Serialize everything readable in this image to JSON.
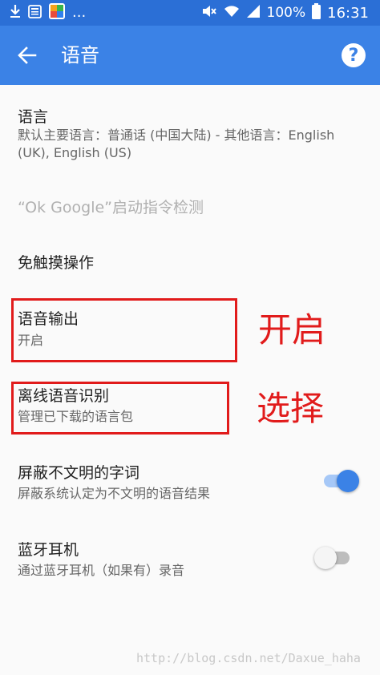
{
  "status_bar": {
    "time": "16:31",
    "battery": "100%",
    "more": "...",
    "icons": [
      "download-icon",
      "news-icon",
      "app-icon",
      "mute-icon",
      "wifi-icon",
      "signal-icon",
      "battery-icon"
    ]
  },
  "app_bar": {
    "title": "语音",
    "help_label": "?",
    "color": "#3b82e6"
  },
  "items": {
    "language": {
      "title": "语言",
      "subtitle": "默认主要语言：普通话 (中国大陆) - 其他语言：English (UK), English (US)"
    },
    "ok_google": {
      "title": "“Ok Google”启动指令检测"
    },
    "handsfree": {
      "title": "免触摸操作"
    },
    "voice_output": {
      "title": "语音输出",
      "subtitle": "开启"
    },
    "offline": {
      "title": "离线语音识别",
      "subtitle": "管理已下载的语言包"
    },
    "block_offensive": {
      "title": "屏蔽不文明的字词",
      "subtitle": "屏蔽系统认定为不文明的语音结果",
      "enabled": true
    },
    "bluetooth": {
      "title": "蓝牙耳机",
      "subtitle": "通过蓝牙耳机（如果有）录音",
      "enabled": false
    }
  },
  "annotations": {
    "voice_output": "开启",
    "offline": "选择",
    "color": "#e11b1b"
  },
  "watermark": "http://blog.csdn.net/Daxue_haha"
}
